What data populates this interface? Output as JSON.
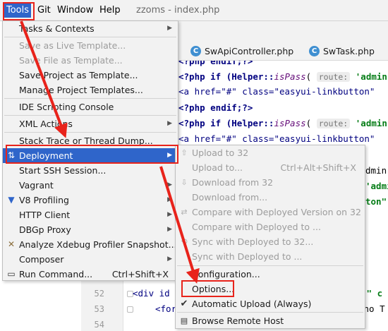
{
  "menubar": {
    "items": [
      {
        "label": "Tools",
        "active": true
      },
      {
        "label": "Git"
      },
      {
        "label": "Window"
      },
      {
        "label": "Help"
      }
    ],
    "window_title": "zzoms - index.php"
  },
  "editor_tabs": [
    {
      "label": "SwApiController.php"
    },
    {
      "label": "SwTask.php"
    }
  ],
  "code": {
    "lines": [
      {
        "text": "<?php endif;?>"
      },
      {
        "pre": "<?php if (Helper::",
        "fn": "isPass",
        "hint": "route:",
        "str": "'admin"
      },
      {
        "pre": "<a href=\"#\" class=\"easyui-linkbutton\""
      },
      {
        "pre": "<?php endif;?>"
      },
      {
        "pre": "<?php if (Helper::",
        "fn": "isPass",
        "hint": "route:",
        "str": "'admin"
      },
      {
        "pre": "<a href=\"#\" class=\"easyui-linkbutton\""
      }
    ],
    "peek": [
      "dmin",
      "'admin",
      "ton\""
    ],
    "line_numbers": [
      "52",
      "53",
      "54"
    ],
    "line52": "<div id",
    "line52_tail": ".\" c",
    "line53": "<for",
    "line53_tail": "cho T"
  },
  "tools_menu": {
    "items": [
      {
        "label": "Tasks & Contexts",
        "submenu": true
      },
      {
        "label": "Save as Live Template...",
        "disabled": true
      },
      {
        "label": "Save File as Template...",
        "disabled": true
      },
      {
        "label": "Save Project as Template..."
      },
      {
        "label": "Manage Project Templates..."
      },
      {
        "label": "IDE Scripting Console"
      },
      {
        "label": "XML Actions",
        "submenu": true
      },
      {
        "label": "Stack Trace or Thread Dump..."
      },
      {
        "label": "Deployment",
        "submenu": true,
        "selected": true
      },
      {
        "label": "Start SSH Session..."
      },
      {
        "label": "Vagrant",
        "submenu": true
      },
      {
        "label": "V8 Profiling",
        "submenu": true
      },
      {
        "label": "HTTP Client",
        "submenu": true
      },
      {
        "label": "DBGp Proxy",
        "submenu": true
      },
      {
        "label": "Analyze Xdebug Profiler Snapshot..."
      },
      {
        "label": "Composer",
        "submenu": true
      },
      {
        "label": "Run Command...",
        "shortcut": "Ctrl+Shift+X"
      }
    ]
  },
  "deployment_submenu": {
    "items": [
      {
        "label": "Upload to 32",
        "disabled": true
      },
      {
        "label": "Upload to...",
        "shortcut": "Ctrl+Alt+Shift+X",
        "disabled": true
      },
      {
        "label": "Download from 32",
        "disabled": true
      },
      {
        "label": "Download from...",
        "disabled": true
      },
      {
        "label": "Compare with Deployed Version on 32",
        "disabled": true
      },
      {
        "label": "Compare with Deployed to ...",
        "disabled": true
      },
      {
        "label": "Sync with Deployed to 32...",
        "disabled": true
      },
      {
        "label": "Sync with Deployed to ...",
        "disabled": true
      },
      {
        "label": "Configuration..."
      },
      {
        "label": "Options..."
      },
      {
        "label": "Automatic Upload (Always)",
        "checked": true
      },
      {
        "label": "Browse Remote Host"
      }
    ]
  },
  "colors": {
    "highlight": "#2f65ca",
    "annotation": "#e8231b",
    "menu_bg": "#f2f2f2",
    "disabled_text": "#9c9c9c"
  }
}
